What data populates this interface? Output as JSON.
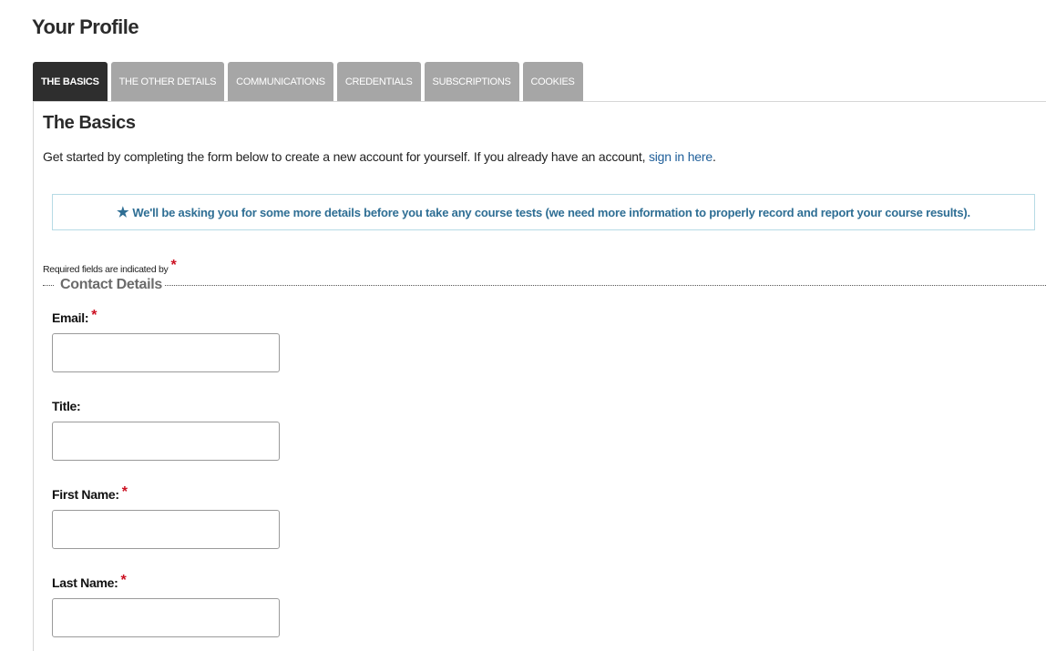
{
  "page": {
    "title": "Your Profile"
  },
  "tabs": [
    {
      "label": "THE BASICS",
      "active": true
    },
    {
      "label": "THE OTHER DETAILS",
      "active": false
    },
    {
      "label": "COMMUNICATIONS",
      "active": false
    },
    {
      "label": "CREDENTIALS",
      "active": false
    },
    {
      "label": "SUBSCRIPTIONS",
      "active": false
    },
    {
      "label": "COOKIES",
      "active": false
    }
  ],
  "section": {
    "title": "The Basics",
    "intro_text": "Get started by completing the form below to create a new account for yourself. If you already have an account, ",
    "intro_link": "sign in here",
    "intro_end": "."
  },
  "notice": {
    "icon": "star-icon",
    "text": "We'll be asking you for some more details before you take any course tests (we need more information to properly record and report your course results)."
  },
  "required_note": {
    "text": "Required fields are indicated by",
    "marker": "*"
  },
  "contact_details": {
    "legend": "Contact Details",
    "fields": [
      {
        "label": "Email:",
        "required": "*",
        "value": "",
        "placeholder": ""
      },
      {
        "label": "Title:",
        "required": "",
        "value": "",
        "placeholder": ""
      },
      {
        "label": "First Name:",
        "required": "*",
        "value": "",
        "placeholder": ""
      },
      {
        "label": "Last Name:",
        "required": "*",
        "value": "",
        "placeholder": ""
      }
    ]
  },
  "colors": {
    "tab_inactive": "#a6a6a6",
    "tab_active": "#2e2e2e",
    "link": "#1f5f9a",
    "notice_text": "#2e6e94",
    "notice_border": "#b7dbe5",
    "required": "#cc1122"
  }
}
